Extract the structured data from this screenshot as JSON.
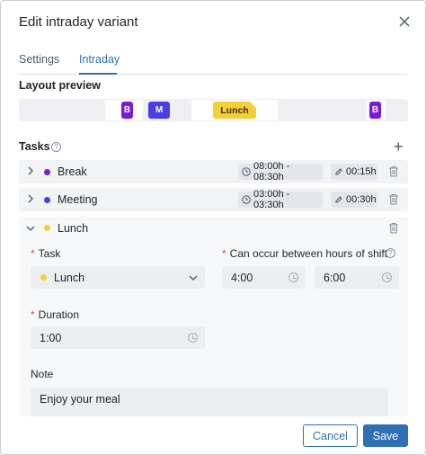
{
  "dialog": {
    "title": "Edit intraday variant"
  },
  "tabs": [
    {
      "label": "Settings"
    },
    {
      "label": "Intraday"
    }
  ],
  "layout_preview": {
    "label": "Layout preview",
    "chips": [
      {
        "label": "B",
        "color": "#7a1bd6"
      },
      {
        "label": "M",
        "color": "#4b3de8"
      },
      {
        "label": "Lunch",
        "color": "#f4cf3a"
      },
      {
        "label": "B",
        "color": "#7a1bd6"
      }
    ]
  },
  "tasks": {
    "label": "Tasks",
    "help_glyph": "?",
    "add_glyph": "+",
    "items": [
      {
        "name": "Break",
        "color": "#7a1bd6",
        "time": "08:00h - 08:30h",
        "duration": "00:15h"
      },
      {
        "name": "Meeting",
        "color": "#4b3de8",
        "time": "03:00h - 03:30h",
        "duration": "00:30h"
      }
    ],
    "expanded": {
      "name": "Lunch",
      "color": "#f4cf3a",
      "task_label": "Task",
      "task_value": "Lunch",
      "occur_label": "Can occur between hours of shift",
      "occur_from": "4:00",
      "occur_to": "6:00",
      "duration_label": "Duration",
      "duration_value": "1:00",
      "note_label": "Note",
      "note_value": "Enjoy your meal",
      "required_mark": "*"
    }
  },
  "footer": {
    "cancel_label": "Cancel",
    "save_label": "Save"
  },
  "colors": {
    "accent": "#2f6fb3",
    "required": "#e5484d"
  }
}
